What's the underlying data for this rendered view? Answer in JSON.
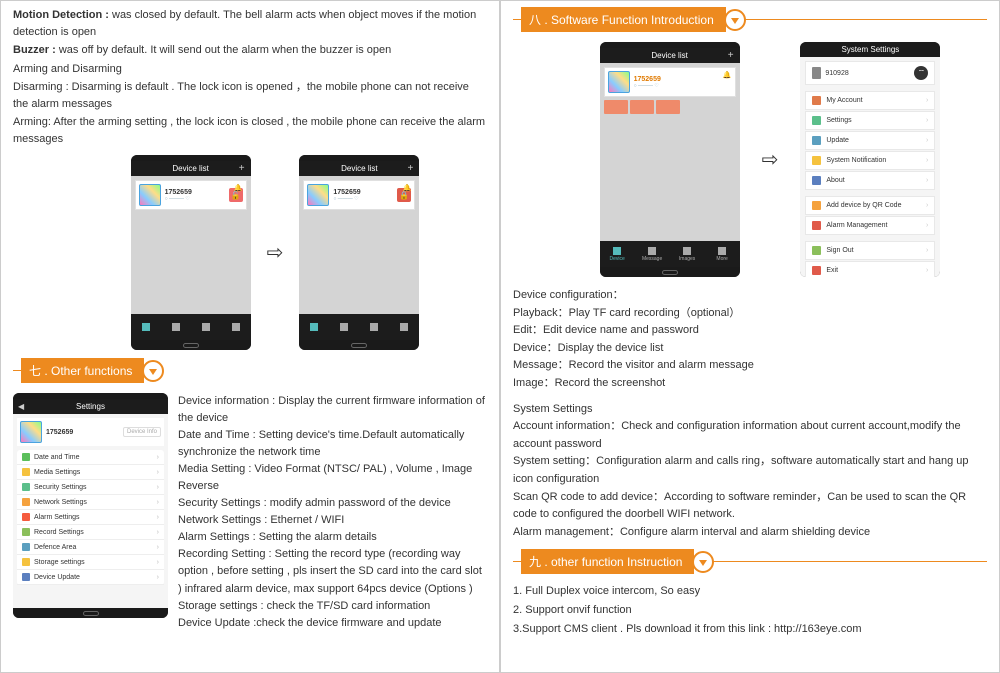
{
  "left": {
    "intro": {
      "motion_label": "Motion Detection :",
      "motion_text": " was closed by default. The bell alarm acts when object moves if the motion detection is open",
      "buzzer_label": "Buzzer :",
      "buzzer_text": " was off by default. It will send out the alarm when the buzzer is open",
      "arming_heading": "Arming and Disarming",
      "disarming": "Disarming : Disarming is default . The lock icon is opened ，the mobile phone can not receive the alarm  messages",
      "arming": "Arming: After the arming setting , the lock icon  is closed , the mobile phone  can  receive the alarm  messages"
    },
    "phone1": {
      "title": "Device list",
      "id": "1752659"
    },
    "phone2": {
      "title": "Device list",
      "id": "1752659"
    },
    "section7_title": "七 .  Other functions",
    "settings_phone": {
      "title": "Settings",
      "id": "1752659",
      "device_info_btn": "Device Info",
      "items": [
        {
          "icon_color": "#5bbf5b",
          "label": "Date and Time"
        },
        {
          "icon_color": "#f5c23e",
          "label": "Media Settings"
        },
        {
          "icon_color": "#5bbf8b",
          "label": "Security Settings"
        },
        {
          "icon_color": "#f5a23e",
          "label": "Network Settings"
        },
        {
          "icon_color": "#f55b3e",
          "label": "Alarm Settings"
        },
        {
          "icon_color": "#8bbf5b",
          "label": "Record Settings"
        },
        {
          "icon_color": "#5b9fbf",
          "label": "Defence Area"
        },
        {
          "icon_color": "#f5c23e",
          "label": "Storage settings"
        },
        {
          "icon_color": "#5b7fbf",
          "label": "Device Update"
        }
      ]
    },
    "desc": {
      "d1": "Device information : Display the current firmware information of the device",
      "d2": "Date and Time : Setting device's time.Default automatically synchronize the network time",
      "d3": "Media Setting : Video  Format (NTSC/ PAL) , Volume , Image Reverse",
      "d4": "Security Settings : modify admin password of  the device",
      "d5": "Network Settings : Ethernet /  WIFI",
      "d6": "Alarm Settings : Setting the alarm details",
      "d7": "Recording Setting : Setting the record type (recording way option , before setting , pls insert the SD card  into the card slot ) infrared alarm device, max support 64pcs device (Options )",
      "d8": "Storage settings : check the TF/SD card information",
      "d9": "Device Update :check the device firmware and update"
    }
  },
  "right": {
    "section8_title": "八 .  Software Function Introduction",
    "phoneA": {
      "title": "Device list",
      "id": "1752659",
      "tabs": [
        "Device",
        "Message",
        "Images",
        "More"
      ]
    },
    "phoneB": {
      "title": "System Settings",
      "user_id": "910928",
      "items": [
        {
          "icon_color": "#e07a4a",
          "label": "My Account"
        },
        {
          "icon_color": "#5bbf8b",
          "label": "Settings"
        },
        {
          "icon_color": "#5b9fbf",
          "label": "Update"
        },
        {
          "icon_color": "#f5c23e",
          "label": "System Notification"
        },
        {
          "icon_color": "#5b7fbf",
          "label": "About"
        }
      ],
      "items2": [
        {
          "icon_color": "#f5a23e",
          "label": "Add device by QR Code"
        },
        {
          "icon_color": "#e05a4a",
          "label": "Alarm Management"
        }
      ],
      "items3": [
        {
          "icon_color": "#8bbf5b",
          "label": "Sign Out"
        },
        {
          "icon_color": "#e05a4a",
          "label": "Exit"
        }
      ]
    },
    "desc1": {
      "h": "Device configuration：",
      "l1": "Playback：Play TF card recording（optional）",
      "l2": "Edit：Edit device name and password",
      "l3": "Device：Display the device list",
      "l4": "Message：Record the visitor and alarm message",
      "l5": "Image：Record the screenshot"
    },
    "desc2": {
      "h": "System Settings",
      "l1": "Account information：Check and configuration information about current account,modify the account password",
      "l2": "System setting：Configuration alarm and calls ring，software automatically start and hang up icon configuration",
      "l3": "Scan QR code to add device：According to software reminder，Can be used to scan the QR code to configured the doorbell WIFI network.",
      "l4": "Alarm management：Configure alarm interval and alarm shielding device"
    },
    "section9_title": "九 .  other function Instruction",
    "list9": {
      "l1": "1. Full Duplex voice intercom, So easy",
      "l2": "2. Support onvif function",
      "l3": "3.Support CMS client . Pls download it from this link : http://163eye.com"
    }
  }
}
